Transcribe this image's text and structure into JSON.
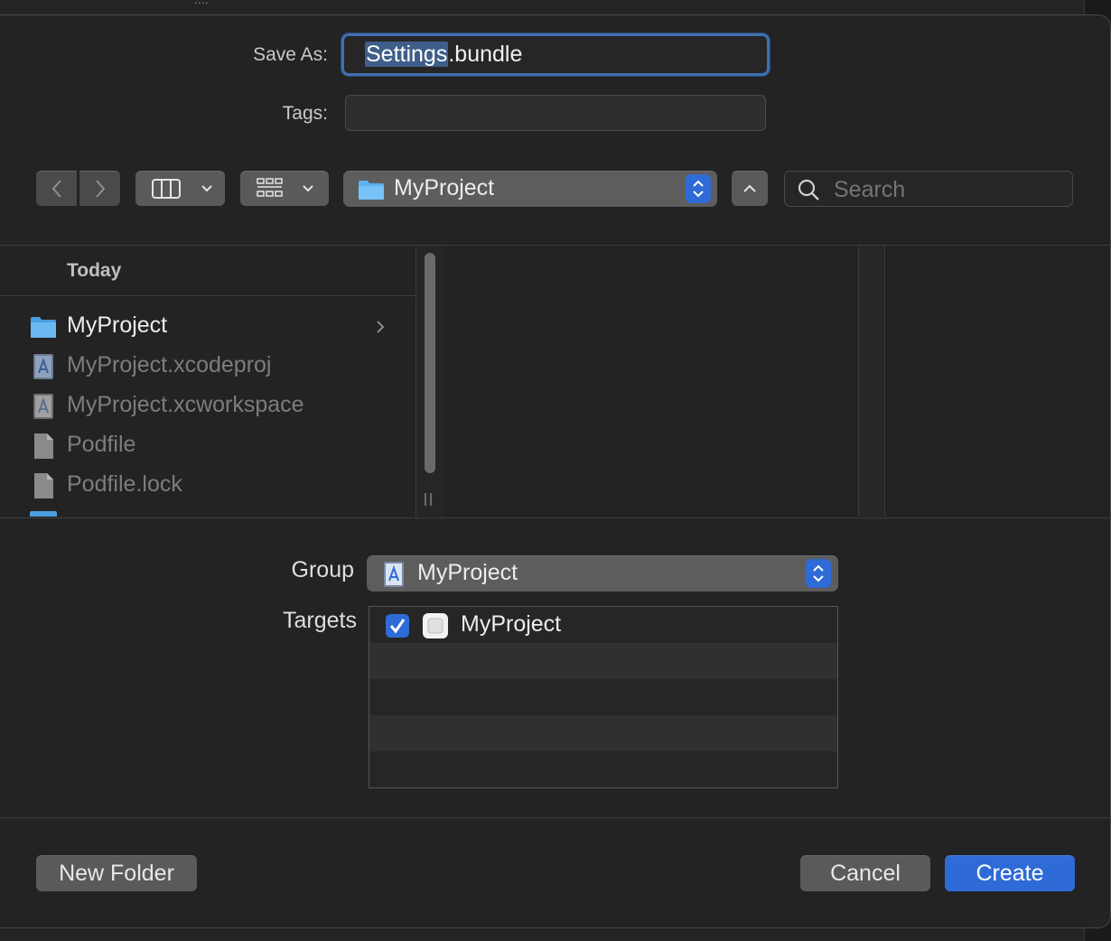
{
  "background_window": {
    "text": "...."
  },
  "save_as": {
    "label": "Save As:",
    "value_selected": "Settings",
    "value_rest": ".bundle"
  },
  "tags": {
    "label": "Tags:",
    "value": ""
  },
  "toolbar": {
    "location": "MyProject",
    "search_placeholder": "Search"
  },
  "browser": {
    "section_header": "Today",
    "items": [
      {
        "name": "MyProject",
        "icon": "folder-icon",
        "enabled": true,
        "has_children": true
      },
      {
        "name": "MyProject.xcodeproj",
        "icon": "xcodeproj-icon",
        "enabled": false
      },
      {
        "name": "MyProject.xcworkspace",
        "icon": "xcworkspace-icon",
        "enabled": false
      },
      {
        "name": "Podfile",
        "icon": "document-icon",
        "enabled": false
      },
      {
        "name": "Podfile.lock",
        "icon": "document-icon",
        "enabled": false
      }
    ]
  },
  "group": {
    "label": "Group",
    "value": "MyProject"
  },
  "targets": {
    "label": "Targets",
    "items": [
      {
        "name": "MyProject",
        "checked": true
      }
    ]
  },
  "buttons": {
    "new_folder": "New Folder",
    "cancel": "Cancel",
    "create": "Create"
  },
  "colors": {
    "accent": "#2f6bd6",
    "sheet_bg": "#232323"
  }
}
